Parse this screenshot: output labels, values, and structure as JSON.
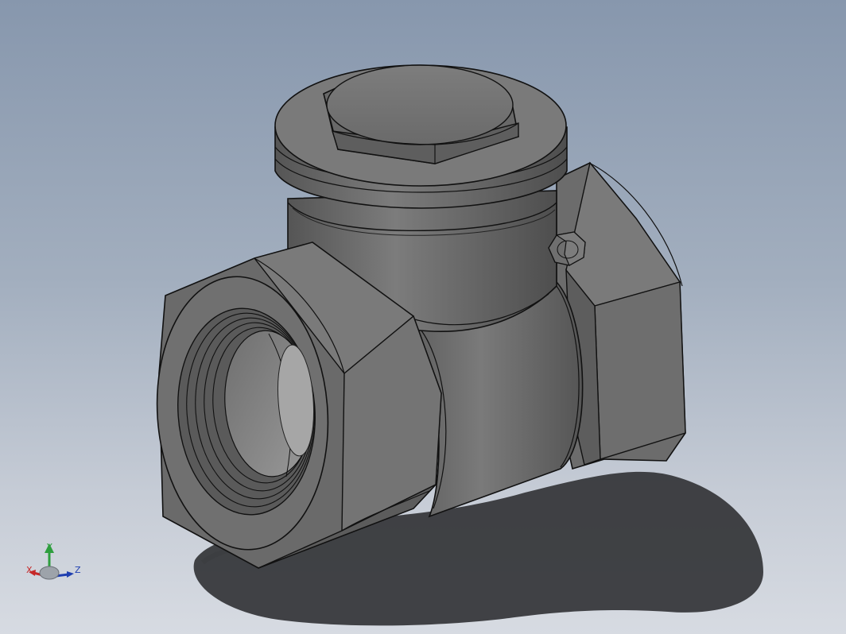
{
  "viewport": {
    "background_top": "#8797ad",
    "background_bottom": "#d7dbe2"
  },
  "model": {
    "part_color": "#6f6f6f",
    "edge_color": "#111111",
    "shadow_color": "#2f3033"
  },
  "triad": {
    "x_label": "X",
    "y_label": "Y",
    "z_label": "Z",
    "x_color": "#c62828",
    "y_color": "#2e9e3e",
    "z_color": "#1f3fb0"
  }
}
